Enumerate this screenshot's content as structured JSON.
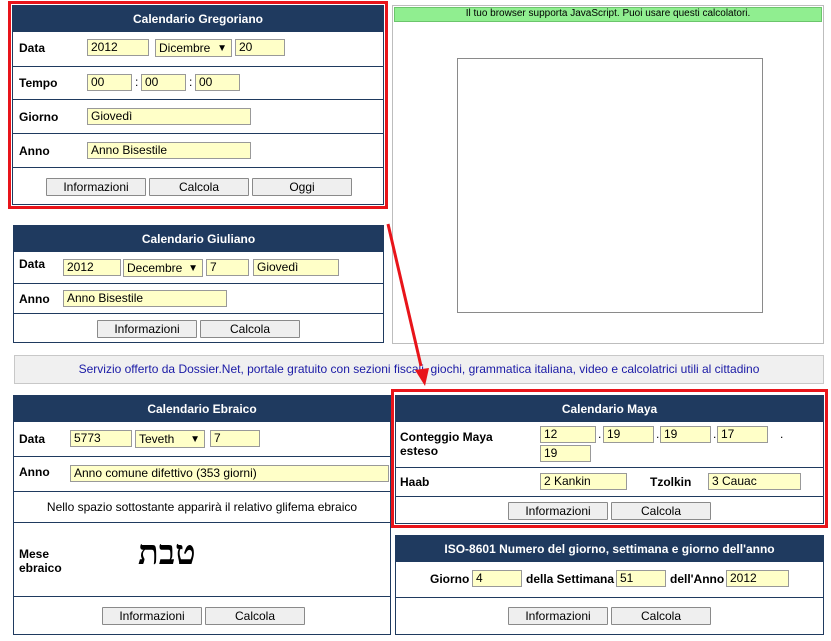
{
  "gregorian": {
    "title": "Calendario Gregoriano",
    "data_label": "Data",
    "year": "2012",
    "month": "Dicembre",
    "day": "20",
    "tempo_label": "Tempo",
    "hh": "00",
    "mm": "00",
    "ss": "00",
    "colon": ":",
    "giorno_label": "Giorno",
    "giorno": "Giovedì",
    "anno_label": "Anno",
    "anno": "Anno Bisestile",
    "btn_info": "Informazioni",
    "btn_calc": "Calcola",
    "btn_today": "Oggi"
  },
  "julian": {
    "title": "Calendario Giuliano",
    "data_label": "Data",
    "year": "2012",
    "month": "Decembre",
    "day": "7",
    "weekday": "Giovedì",
    "anno_label": "Anno",
    "anno": "Anno Bisestile",
    "btn_info": "Informazioni",
    "btn_calc": "Calcola"
  },
  "js_notice": "Il tuo browser supporta JavaScript. Puoi usare questi calcolatori.",
  "service_banner": "Servizio offerto da Dossier.Net, portale gratuito con sezioni fiscali, giochi, grammatica italiana, video e calcolatrici utili al cittadino",
  "hebrew": {
    "title": "Calendario Ebraico",
    "data_label": "Data",
    "year": "5773",
    "month": "Teveth",
    "day": "7",
    "anno_label": "Anno",
    "anno": "Anno comune difettivo (353 giorni)",
    "note": "Nello spazio sottostante apparirà il relativo glifema ebraico",
    "mese_label": "Mese ebraico",
    "glyph": "טבת",
    "btn_info": "Informazioni",
    "btn_calc": "Calcola"
  },
  "maya": {
    "title": "Calendario Maya",
    "conteggio_label": "Conteggio Maya esteso",
    "c1": "12",
    "c2": "19",
    "c3": "19",
    "c4": "17",
    "c5": "19",
    "dot": ".",
    "haab_label": "Haab",
    "haab": "2 Kankin",
    "tzolkin_label": "Tzolkin",
    "tzolkin": "3 Cauac",
    "btn_info": "Informazioni",
    "btn_calc": "Calcola"
  },
  "iso": {
    "title": "ISO-8601 Numero del giorno, settimana e giorno dell'anno",
    "giorno_label": "Giorno",
    "giorno": "4",
    "settimana_label": "della Settimana",
    "settimana": "51",
    "anno_label": "dell'Anno",
    "anno": "2012",
    "btn_info": "Informazioni",
    "btn_calc": "Calcola"
  },
  "colors": {
    "header": "#1f3a5f",
    "field": "#ffffc8",
    "highlight": "#e8141a",
    "notice": "#90ee90",
    "banner_text": "#1a1aa6"
  }
}
